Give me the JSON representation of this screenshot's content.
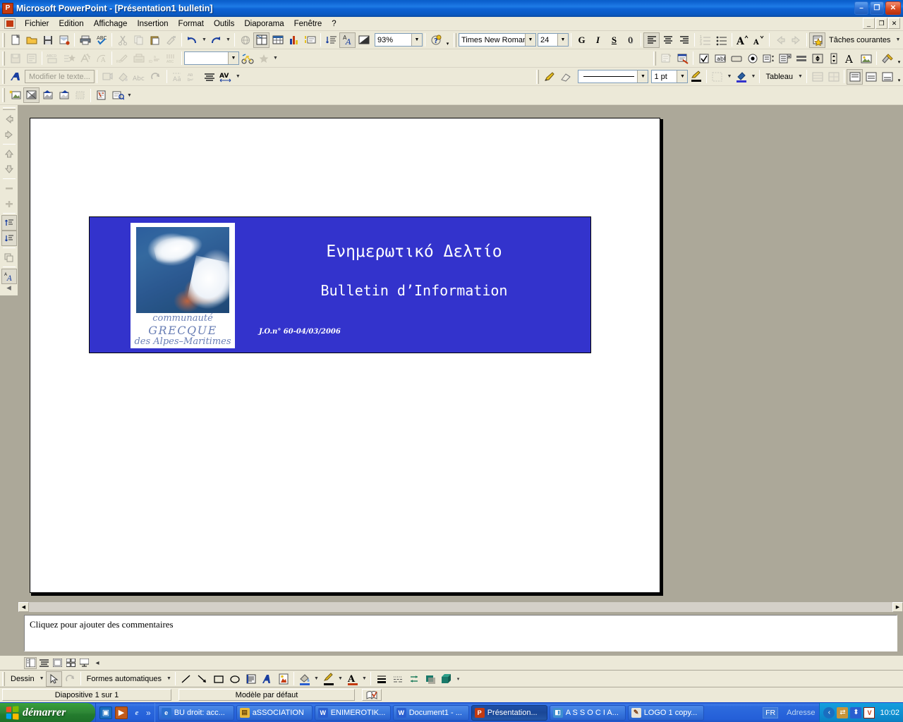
{
  "window": {
    "title": "Microsoft PowerPoint - [Présentation1  bulletin]",
    "app_icon": "powerpoint-icon",
    "minimize": "–",
    "restore": "❐",
    "close": "✕"
  },
  "menubar": {
    "doc_icon": "document-icon",
    "items": [
      "Fichier",
      "Edition",
      "Affichage",
      "Insertion",
      "Format",
      "Outils",
      "Diaporama",
      "Fenêtre",
      "?"
    ],
    "win_minimize": "_",
    "win_restore": "❐",
    "win_close": "✕"
  },
  "toolbar_standard": {
    "buttons": [
      "new-icon",
      "open-icon",
      "save-icon",
      "mail-icon",
      "print-icon",
      "spellcheck-icon",
      "cut-icon",
      "copy-icon",
      "paste-icon",
      "format-painter-icon"
    ],
    "undo": "undo-icon",
    "redo": "redo-icon",
    "hyperlink": "hyperlink-icon",
    "table-grid": "insert-table-icon",
    "insert-table": "table-icon",
    "insert-chart": "chart-icon",
    "new-slide": "new-slide-icon",
    "outline": "expand-all-icon",
    "format-ab": "format-ab-icon",
    "bw-view": "grayscale-icon",
    "zoom_value": "93%",
    "help": "help-icon",
    "overflow": "▾"
  },
  "toolbar_format": {
    "font_name": "Times New Roman",
    "font_size": "24",
    "bold": "G",
    "italic": "I",
    "underline": "S",
    "shadow": "0",
    "align_left": "align-left-icon",
    "align_center": "align-center-icon",
    "align_right": "align-right-icon",
    "numbering": "numbering-icon",
    "bullets": "bullets-icon",
    "increase_font": "increase-font-icon",
    "decrease_font": "decrease-font-icon",
    "promote": "promote-icon",
    "demote": "demote-icon",
    "tasks_icon": "task-star-icon",
    "tasks_label": "Tâches courantes",
    "overflow": "▾"
  },
  "toolbar_reviewing": {
    "buttons": [
      "save-view-icon",
      "outline-view-icon",
      "abc-translate-icon",
      "star-effect-icon",
      "animation-icon",
      "wordart-icon",
      "rb-pen-icon",
      "typewriter-icon",
      "id-icon",
      "abc-bars-icon",
      "bike-icon",
      "star-dim-icon"
    ],
    "combo_value": "",
    "controls": [
      "properties-icon",
      "view-code-icon",
      "checkbox-icon",
      "textbox-icon",
      "button-icon",
      "option-icon",
      "listbox-icon",
      "combobox-icon",
      "toggle-icon",
      "spin-icon",
      "scroll-icon",
      "label-icon",
      "image-icon",
      "more-controls-icon"
    ],
    "overflow": "▾"
  },
  "toolbar_tables": {
    "wordart_icon": "wordart-blue-icon",
    "edit_text_label": "Modifier le texte...",
    "buttons": [
      "shape-icon",
      "fill-effects-icon",
      "abc-spell-icon",
      "rotate-icon",
      "align-text-icon",
      "wrap-text-icon",
      "justify-icon",
      "kerning-icon"
    ],
    "draw_pen": "pencil-icon",
    "eraser": "eraser-icon",
    "line_style_value": "───────────",
    "line_weight_value": "1 pt",
    "border_pen_color": "border-color-icon",
    "borders_icon": "borders-icon",
    "shading_icon": "shading-icon",
    "table_label": "Tableau",
    "merge_icon": "merge-cells-icon",
    "split_icon": "split-cells-icon",
    "align_top_icon": "align-top-icon",
    "align_middle_icon": "align-middle-icon",
    "align_bottom_icon": "align-bottom-icon",
    "overflow": "▾"
  },
  "toolbar_picture": {
    "buttons": [
      "insert-picture-icon",
      "color-image-icon",
      "more-contrast-icon",
      "less-contrast-icon",
      "crop-icon",
      "recolor-icon",
      "format-picture-icon"
    ],
    "overflow": "▾"
  },
  "vertical_toolbar": {
    "buttons": [
      "prev-icon",
      "next-icon",
      "up-icon",
      "down-icon",
      "collapse-icon",
      "expand-icon",
      "collapse-all-icon",
      "expand-all-icon",
      "summary-slide-icon",
      "show-formatting-icon"
    ],
    "overflow": "◂"
  },
  "slide": {
    "logo": {
      "alt": "communaute-grecque-logo",
      "line1": "communauté",
      "line2": "GRECQUE",
      "line3": "des Alpes–Maritimes"
    },
    "title_greek": "Ενημερωτικό Δελτίο",
    "title_french": "Bulletin d’Information",
    "issue_line": "J.O.n° 60-04/03/2006",
    "colors": {
      "title_box_bg": "#3333CC",
      "title_text": "#FFFFFF",
      "slide_bg": "#FFFFFF"
    }
  },
  "notes": {
    "placeholder": "Cliquez pour ajouter des commentaires"
  },
  "view_buttons": {
    "items": [
      "normal-view-icon",
      "outline-view-icon",
      "slide-view-icon",
      "slide-sorter-icon",
      "slide-show-icon"
    ],
    "overflow": "◂"
  },
  "drawing_toolbar": {
    "draw_label": "Dessin",
    "select_icon": "select-arrow-icon",
    "rotate_icon": "free-rotate-icon",
    "autoshapes_label": "Formes automatiques",
    "line_icon": "line-icon",
    "arrow_icon": "arrow-icon",
    "rect_icon": "rectangle-icon",
    "oval_icon": "oval-icon",
    "textbox_icon": "text-box-icon",
    "wordart_icon": "insert-wordart-icon",
    "clipart_icon": "insert-clipart-icon",
    "fill_color_icon": "fill-color-icon",
    "line_color_icon": "line-color-icon",
    "font_color_icon": "font-color-icon",
    "line_style_icon": "line-style-icon",
    "dash_style_icon": "dash-style-icon",
    "arrow_style_icon": "arrow-style-icon",
    "shadow_icon": "shadow-icon",
    "3d_icon": "three-d-icon",
    "overflow": "▾"
  },
  "statusbar": {
    "slide_info": "Diapositive 1 sur 1",
    "template": "Modèle par défaut",
    "spell_icon": "spelling-status-icon"
  },
  "taskbar": {
    "start_label": "démarrer",
    "quick_launch": [
      "show-desktop-icon",
      "media-player-icon",
      "internet-explorer-icon"
    ],
    "quick_overflow": "»",
    "tasks": [
      {
        "label": "BU droit: acc...",
        "icon": "ie-doc-icon",
        "active": false
      },
      {
        "label": "aSSOCIATION",
        "icon": "folder-icon",
        "active": false
      },
      {
        "label": "ENIMEROTIK...",
        "icon": "word-icon",
        "active": false
      },
      {
        "label": "Document1 - ...",
        "icon": "word-icon",
        "active": false
      },
      {
        "label": "Présentation...",
        "icon": "powerpoint-icon",
        "active": true
      },
      {
        "label": "A S S O C I A...",
        "icon": "image-icon",
        "active": false
      },
      {
        "label": "LOGO 1 copy...",
        "icon": "paint-icon",
        "active": false
      }
    ],
    "language": "FR",
    "address_label": "Adresse",
    "tray_icons": [
      "chevron-left-icon",
      "network-icon",
      "update-icon",
      "antivirus-icon"
    ],
    "clock": "10:02"
  }
}
